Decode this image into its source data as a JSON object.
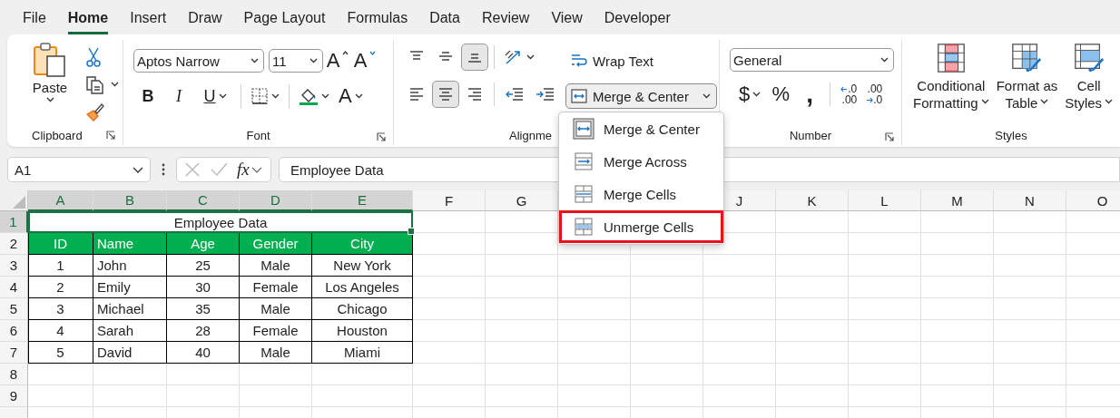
{
  "menu_tabs": [
    {
      "label": "File",
      "selected": false
    },
    {
      "label": "Home",
      "selected": true
    },
    {
      "label": "Insert",
      "selected": false
    },
    {
      "label": "Draw",
      "selected": false
    },
    {
      "label": "Page Layout",
      "selected": false
    },
    {
      "label": "Formulas",
      "selected": false
    },
    {
      "label": "Data",
      "selected": false
    },
    {
      "label": "Review",
      "selected": false
    },
    {
      "label": "View",
      "selected": false
    },
    {
      "label": "Developer",
      "selected": false
    }
  ],
  "clipboard": {
    "label": "Clipboard",
    "paste": "Paste"
  },
  "font": {
    "label": "Font",
    "font_name": "Aptos Narrow",
    "font_size": "11",
    "grow": "A",
    "shrink": "A",
    "bold": "B",
    "italic": "I",
    "underline": "U",
    "font_color": "A"
  },
  "alignment": {
    "label": "Alignme",
    "vertical": [
      {
        "selected": false
      },
      {
        "selected": false
      },
      {
        "selected": true
      }
    ],
    "horizontal": [
      {
        "selected": false
      },
      {
        "selected": true
      },
      {
        "selected": false
      }
    ],
    "wrap_text": "Wrap Text",
    "merge": "Merge & Center",
    "merge_expanded": true
  },
  "number": {
    "label": "Number",
    "format": "General",
    "currency": "$",
    "percent": "%",
    "comma": ",",
    "decimals": [
      {
        "kind": "increase",
        "top": ".0",
        "bottom": ".00"
      },
      {
        "kind": "decrease",
        "top": ".00",
        "bottom": ".0"
      }
    ]
  },
  "styles": {
    "label": "Styles",
    "buttons": [
      {
        "kind": "conditional",
        "lines": [
          "Conditional",
          "Formatting"
        ]
      },
      {
        "kind": "table",
        "lines": [
          "Format as",
          "Table"
        ]
      },
      {
        "kind": "cell",
        "lines": [
          "Cell",
          "Styles"
        ]
      }
    ]
  },
  "formula_bar": {
    "name_box": "A1",
    "function": "fx",
    "formula": "Employee Data"
  },
  "sheet": {
    "columns": [
      {
        "label": "A",
        "highlighted": true
      },
      {
        "label": "B",
        "highlighted": true
      },
      {
        "label": "C",
        "highlighted": true
      },
      {
        "label": "D",
        "highlighted": true
      },
      {
        "label": "E",
        "highlighted": true
      },
      {
        "label": "F",
        "highlighted": false
      },
      {
        "label": "G",
        "highlighted": false
      },
      {
        "label": "J",
        "highlighted": false
      },
      {
        "label": "K",
        "highlighted": false
      },
      {
        "label": "L",
        "highlighted": false
      },
      {
        "label": "M",
        "highlighted": false
      },
      {
        "label": "N",
        "highlighted": false
      },
      {
        "label": "O",
        "highlighted": false
      }
    ],
    "rows": [
      {
        "label": "1",
        "highlighted": true
      },
      {
        "label": "2",
        "highlighted": false
      },
      {
        "label": "3",
        "highlighted": false
      },
      {
        "label": "4",
        "highlighted": false
      },
      {
        "label": "5",
        "highlighted": false
      },
      {
        "label": "6",
        "highlighted": false
      },
      {
        "label": "7",
        "highlighted": false
      },
      {
        "label": "8",
        "highlighted": false
      },
      {
        "label": "9",
        "highlighted": false
      },
      {
        "highlighted": false
      }
    ],
    "table": {
      "title": "Employee Data",
      "columns": [
        {
          "header": "ID",
          "kind": "center"
        },
        {
          "header": "Name",
          "kind": "left"
        },
        {
          "header": "Age",
          "kind": "center"
        },
        {
          "header": "Gender",
          "kind": "center"
        },
        {
          "header": "City",
          "kind": "center"
        }
      ],
      "rows": [
        [
          "1",
          "John",
          "25",
          "Male",
          "New York"
        ],
        [
          "2",
          "Emily",
          "30",
          "Female",
          "Los Angeles"
        ],
        [
          "3",
          "Michael",
          "35",
          "Male",
          "Chicago"
        ],
        [
          "4",
          "Sarah",
          "28",
          "Female",
          "Houston"
        ],
        [
          "5",
          "David",
          "40",
          "Male",
          "Miami"
        ]
      ]
    }
  },
  "merge_menu": [
    {
      "kind": "center",
      "label": "Merge & Center",
      "highlighted": false
    },
    {
      "kind": "across",
      "label": "Merge Across",
      "highlighted": false
    },
    {
      "kind": "cells",
      "label": "Merge Cells",
      "highlighted": false
    },
    {
      "kind": "unmerge",
      "label": "Unmerge Cells",
      "highlighted": true
    }
  ]
}
